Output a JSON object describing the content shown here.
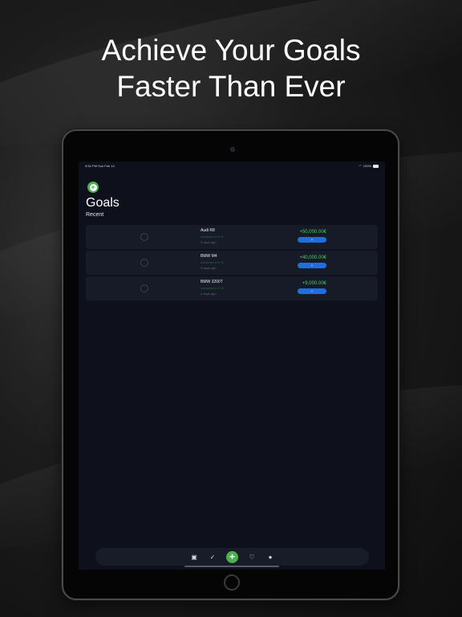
{
  "headline": {
    "line1": "Achieve Your Goals",
    "line2": "Faster Than Ever"
  },
  "statusbar": {
    "time": "5:54 PM",
    "date": "Sun Feb 14",
    "battery": "100%"
  },
  "page": {
    "title": "Goals",
    "section": "Recent"
  },
  "goals": [
    {
      "name": "Audi R8",
      "achieved": "Achieved in 0 %",
      "time": "3 days ago",
      "amount": "+50,000.00€"
    },
    {
      "name": "BMW M4",
      "achieved": "Achieved in 0 %",
      "time": "3 days ago",
      "amount": "+40,000.00€"
    },
    {
      "name": "BMW 3200T",
      "achieved": "Achieved in 0 %",
      "time": "a days ago",
      "amount": "+9,000.00€"
    }
  ],
  "icons": {
    "expand": "chevron-down-icon",
    "tabs": [
      "wallet-icon",
      "check-circle-icon",
      "plus-icon",
      "heart-icon",
      "profile-icon"
    ]
  },
  "colors": {
    "accent_green": "#4caf50",
    "amount_green": "#3dd35a",
    "button_blue": "#1f6fe0",
    "screen_bg": "#0e111b",
    "card_bg": "#171b28"
  }
}
